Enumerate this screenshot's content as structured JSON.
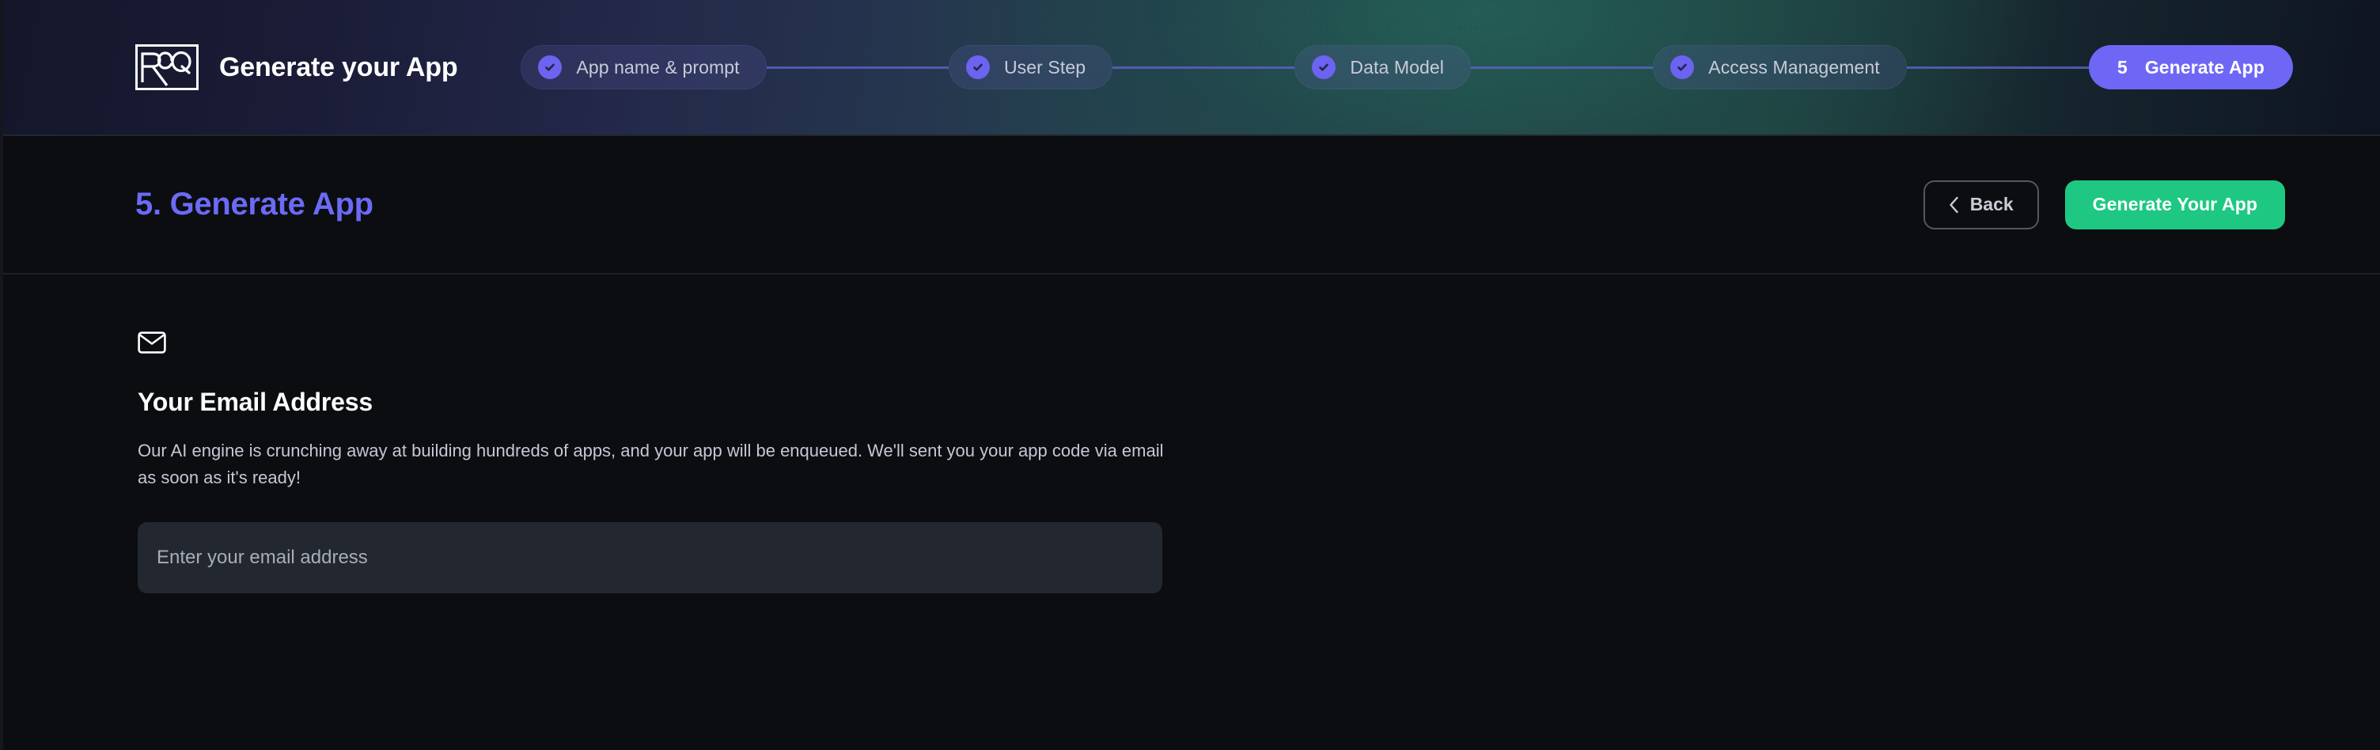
{
  "header": {
    "brand_title": "Generate your App",
    "logo_text": "RCQ",
    "steps": [
      {
        "id": "app-name-prompt",
        "label": "App name & prompt",
        "state": "complete",
        "icon": "check-icon"
      },
      {
        "id": "user-step",
        "label": "User Step",
        "state": "complete",
        "icon": "check-icon"
      },
      {
        "id": "data-model",
        "label": "Data Model",
        "state": "complete",
        "icon": "check-icon"
      },
      {
        "id": "access-management",
        "label": "Access Management",
        "state": "complete",
        "icon": "check-icon"
      },
      {
        "id": "generate-app",
        "label": "Generate App",
        "state": "active",
        "number": "5"
      }
    ]
  },
  "titlebar": {
    "title": "5. Generate App",
    "back_label": "Back",
    "back_icon": "chevron-left-icon",
    "primary_label": "Generate Your App"
  },
  "main": {
    "icon": "mail-icon",
    "section_title": "Your Email Address",
    "description": "Our AI engine is crunching away at building hundreds of apps, and your app will be enqueued. We'll sent you your app code via email as soon as it's ready!",
    "email_placeholder": "Enter your email address",
    "email_value": ""
  },
  "colors": {
    "accent_indigo": "#6e67f5",
    "accent_green": "#1ec883",
    "page_background": "#0b0d11",
    "input_background": "#23272f",
    "title_color": "#6c6af5"
  }
}
